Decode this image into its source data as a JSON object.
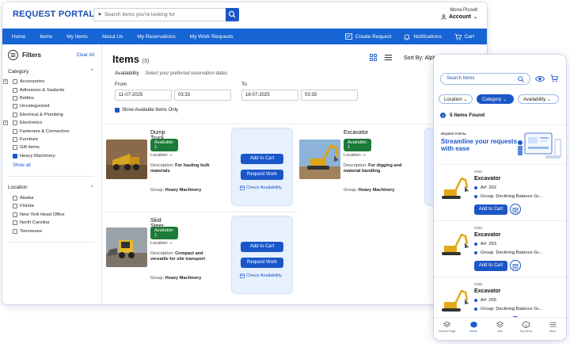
{
  "header": {
    "logo": "REQUEST PORTAL",
    "search_placeholder": "Search items you're looking for",
    "user_name": "Mona Picoult",
    "account_label": "Account"
  },
  "nav": {
    "items": [
      "Home",
      "Items",
      "My Items",
      "About Us",
      "My Reservations",
      "My Work Requests"
    ],
    "create_request": "Create Request",
    "notifications": "Notifications",
    "cart": "Cart"
  },
  "filters": {
    "title": "Filters",
    "clear_all": "Clear All",
    "category": {
      "title": "Category",
      "options": [
        {
          "label": "Accessories",
          "checked": false,
          "expandable": true
        },
        {
          "label": "Adhesives & Sealants",
          "checked": false,
          "expandable": false
        },
        {
          "label": "Bottles",
          "checked": false,
          "expandable": false
        },
        {
          "label": "Uncategorized",
          "checked": false,
          "expandable": false
        },
        {
          "label": "Electrical & Plumbing",
          "checked": false,
          "expandable": false
        },
        {
          "label": "Electronics",
          "checked": false,
          "expandable": true
        },
        {
          "label": "Fasteners & Connectors",
          "checked": false,
          "expandable": false
        },
        {
          "label": "Furniture",
          "checked": false,
          "expandable": false
        },
        {
          "label": "Gift Items",
          "checked": false,
          "expandable": false
        },
        {
          "label": "Heavy Machinery",
          "checked": true,
          "expandable": false
        }
      ],
      "show_all": "Show all"
    },
    "location": {
      "title": "Location",
      "options": [
        {
          "label": "Alaska",
          "checked": false
        },
        {
          "label": "Florida",
          "checked": false
        },
        {
          "label": "New York Head Office",
          "checked": false
        },
        {
          "label": "North Carolina",
          "checked": false
        },
        {
          "label": "Tennessee",
          "checked": false
        }
      ]
    }
  },
  "main": {
    "title": "Items",
    "count": "(3)",
    "sort_label": "Sort By: Alph",
    "availability": {
      "title": "Availability",
      "hint": "Select your preferred reservation dates",
      "from_label": "From",
      "to_label": "To",
      "from_date": "11-07-2025",
      "from_time": "03:33",
      "to_date": "18-07-2025",
      "to_time": "03:33",
      "show_available": "Show Available Items Only"
    },
    "location_label": "Location:",
    "description_label": "Description:",
    "group_label": "Group:",
    "add_to_cart": "Add to Cart",
    "request_work": "Request Work",
    "check_availability": "Check Availability",
    "items": [
      {
        "name": "Dump Truck",
        "status": "Available: 1",
        "location": "--",
        "description": "For hauling bulk materials",
        "group": "Heavy Machinery"
      },
      {
        "name": "Excavator",
        "status": "Available: 1",
        "location": "--",
        "description": "For digging and material handling",
        "group": "Heavy Machinery"
      },
      {
        "name": "Skid Steer Loader",
        "status": "Available: 1",
        "location": "--",
        "description": "Compact and versatile for site transport",
        "group": "Heavy Machinery"
      }
    ]
  },
  "mobile": {
    "search_placeholder": "Search Items",
    "filters": [
      "Location",
      "Category",
      "Availability"
    ],
    "found": "5 Items Found",
    "banner_brand": "REQUEST PORTAL",
    "banner_text": "Streamline your requests with ease",
    "add_to_cart": "Add to Cart",
    "items": [
      {
        "id": "#262",
        "name": "Excavator",
        "asset": "A#: 262",
        "group": "Group: Declining Balance Gr..."
      },
      {
        "id": "#263",
        "name": "Excavator",
        "asset": "A#: 263",
        "group": "Group: Declining Balance Gr..."
      },
      {
        "id": "#265",
        "name": "Excavator",
        "asset": "A#: 265",
        "group": "Group: Declining Balance Gr..."
      }
    ],
    "tabs": [
      "Default Page",
      "Items",
      "Bilk",
      "My Items",
      "More"
    ]
  },
  "colors": {
    "primary": "#1a56c8",
    "nav": "#1764d4",
    "available": "#1e7a39",
    "action_panel": "#e6f1fd"
  }
}
